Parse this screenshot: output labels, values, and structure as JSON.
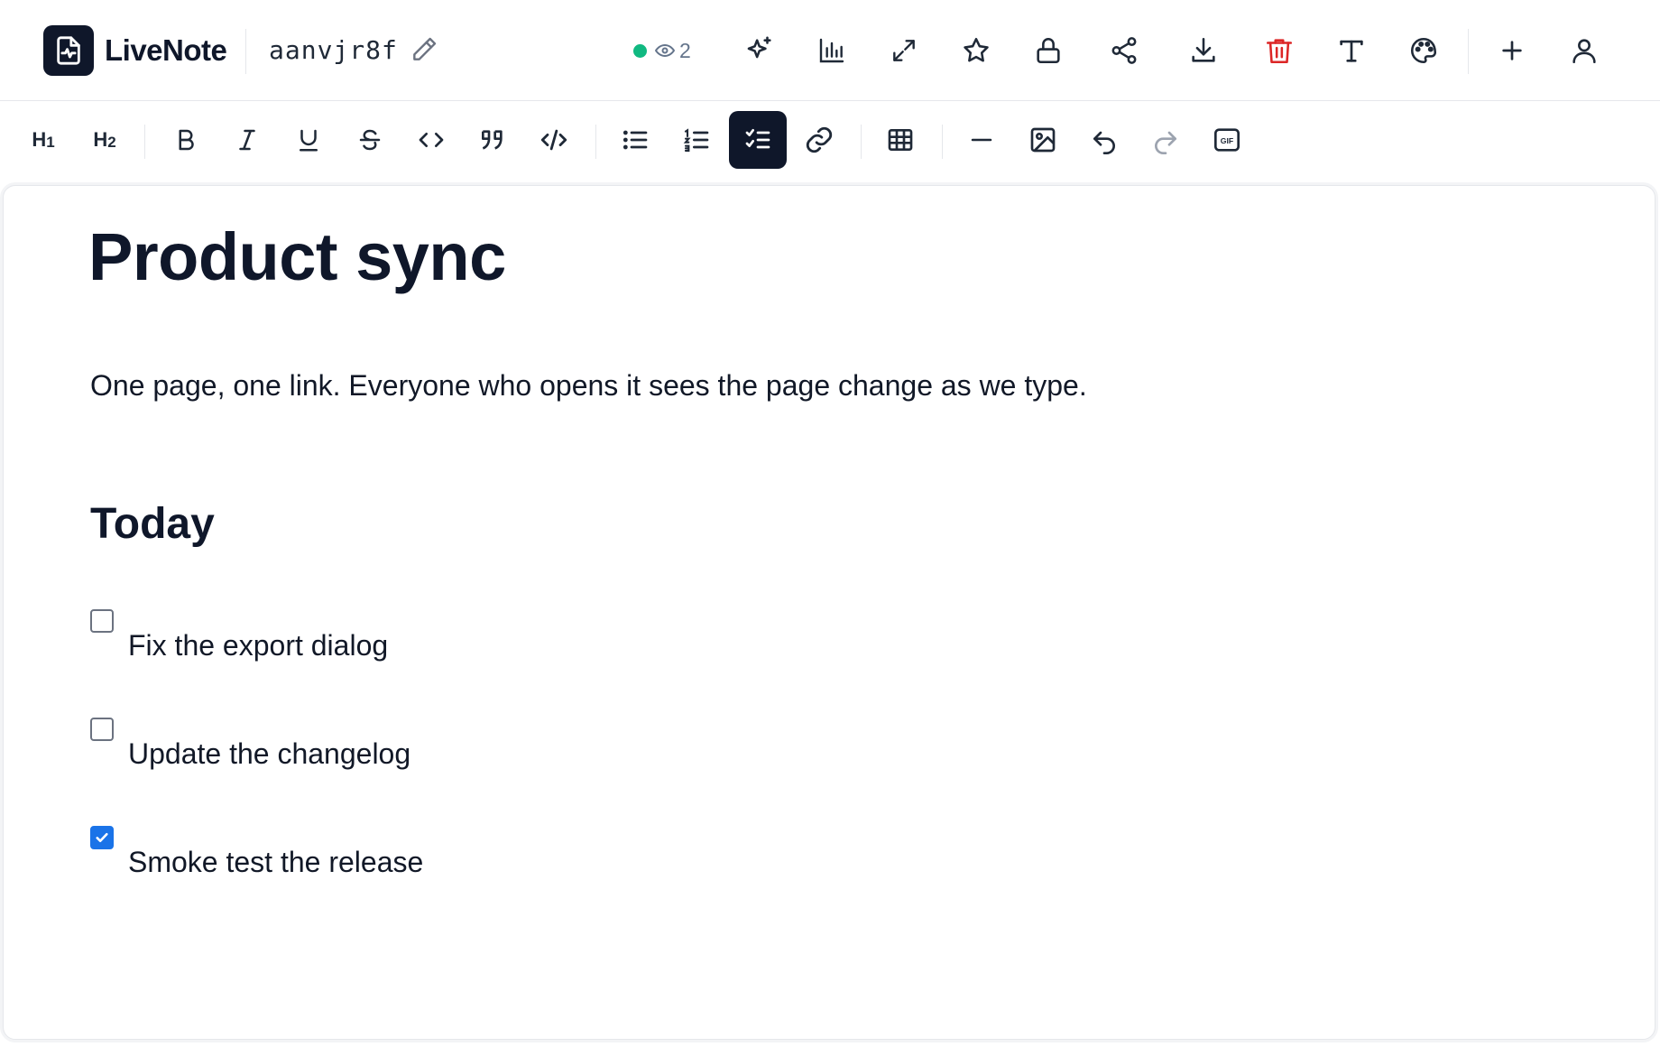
{
  "header": {
    "app_name": "LiveNote",
    "doc_id": "aanvjr8f",
    "presence": {
      "online": true,
      "viewer_count": "2"
    },
    "actions": [
      {
        "icon": "sparkles-icon",
        "label": "AI assist"
      },
      {
        "icon": "bar-chart-icon",
        "label": "Stats"
      },
      {
        "icon": "expand-icon",
        "label": "Fullscreen"
      },
      {
        "icon": "star-icon",
        "label": "Favorite"
      },
      {
        "icon": "lock-icon",
        "label": "Lock"
      },
      {
        "icon": "share-icon",
        "label": "Share"
      },
      {
        "icon": "download-icon",
        "label": "Download"
      },
      {
        "icon": "trash-icon",
        "label": "Delete"
      },
      {
        "icon": "text-icon",
        "label": "Font"
      },
      {
        "icon": "palette-icon",
        "label": "Theme"
      },
      {
        "icon": "plus-icon",
        "label": "New"
      },
      {
        "icon": "user-icon",
        "label": "Account"
      }
    ],
    "colors": {
      "delete": "#dc2626",
      "presence_dot": "#10b981"
    }
  },
  "toolbar": {
    "h1_label": "H",
    "h1_sub": "1",
    "h2_label": "H",
    "h2_sub": "2",
    "active_tool": "task-list",
    "tools": [
      "heading-1",
      "heading-2",
      "bold",
      "italic",
      "underline",
      "strikethrough",
      "inline-code",
      "blockquote",
      "code-block",
      "bullet-list",
      "ordered-list",
      "task-list",
      "link",
      "table",
      "horizontal-rule",
      "image",
      "undo",
      "redo",
      "gif"
    ],
    "disabled_tools": [
      "redo"
    ]
  },
  "document": {
    "title": "Product sync",
    "paragraph": "One page, one link. Everyone who opens it sees the page change as we type.",
    "section_heading": "Today",
    "tasks": [
      {
        "label": "Fix the export dialog",
        "checked": false
      },
      {
        "label": "Update the changelog",
        "checked": false
      },
      {
        "label": "Smoke test the release",
        "checked": true
      }
    ]
  }
}
